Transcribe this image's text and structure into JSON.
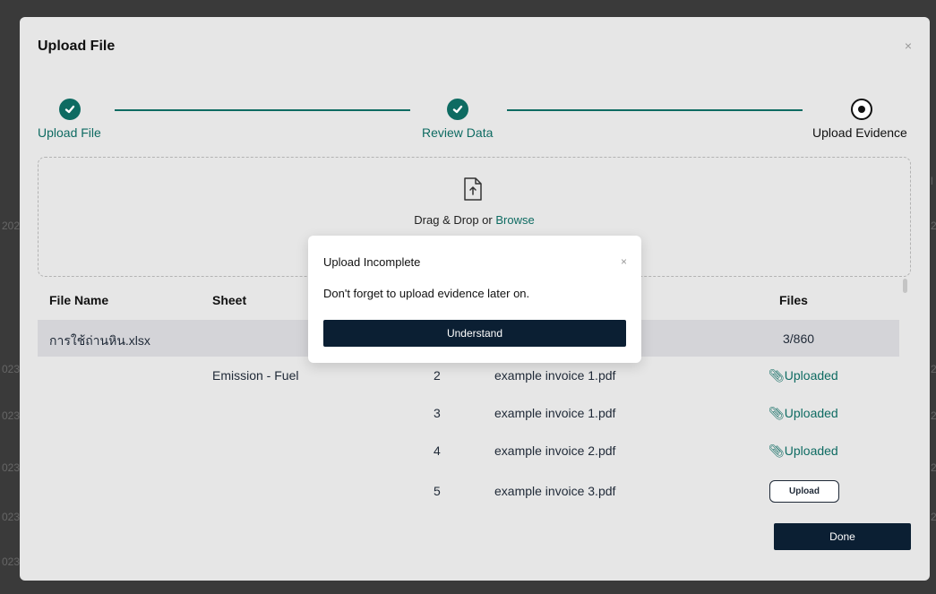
{
  "background": {
    "edge_fragments": [
      "202",
      "023",
      "023",
      "023",
      "023",
      "023",
      "l",
      "2",
      "2",
      "2",
      "2",
      "2"
    ]
  },
  "modal": {
    "title": "Upload File",
    "close_glyph": "×"
  },
  "stepper": {
    "steps": [
      {
        "label": "Upload File",
        "state": "done"
      },
      {
        "label": "Review Data",
        "state": "done"
      },
      {
        "label": "Upload Evidence",
        "state": "active"
      }
    ]
  },
  "dropzone": {
    "text": "Drag & Drop or ",
    "link": "Browse",
    "icon": "file-upload-icon"
  },
  "table": {
    "headers": {
      "file_name": "File Name",
      "sheet": "Sheet",
      "files": "Files"
    },
    "file_row": {
      "file_name": "การใช้ถ่านหิน.xlsx",
      "files": "3/860"
    },
    "rows": [
      {
        "sheet": "Emission - Fuel",
        "row": "2",
        "file": "example invoice 1.pdf",
        "status": "Uploaded"
      },
      {
        "sheet": "",
        "row": "3",
        "file": "example invoice 1.pdf",
        "status": "Uploaded"
      },
      {
        "sheet": "",
        "row": "4",
        "file": "example invoice 2.pdf",
        "status": "Uploaded"
      },
      {
        "sheet": "",
        "row": "5",
        "file": "example invoice 3.pdf",
        "status": "Upload"
      }
    ]
  },
  "done_label": "Done",
  "popup": {
    "title": "Upload Incomplete",
    "message": "Don't forget to upload evidence later on.",
    "button": "Understand",
    "close_glyph": "×"
  },
  "colors": {
    "accent": "#0e6b62",
    "primary_button": "#0b1f33",
    "modal_bg": "#e6e6e6",
    "row_highlight": "#d4d4d8"
  }
}
